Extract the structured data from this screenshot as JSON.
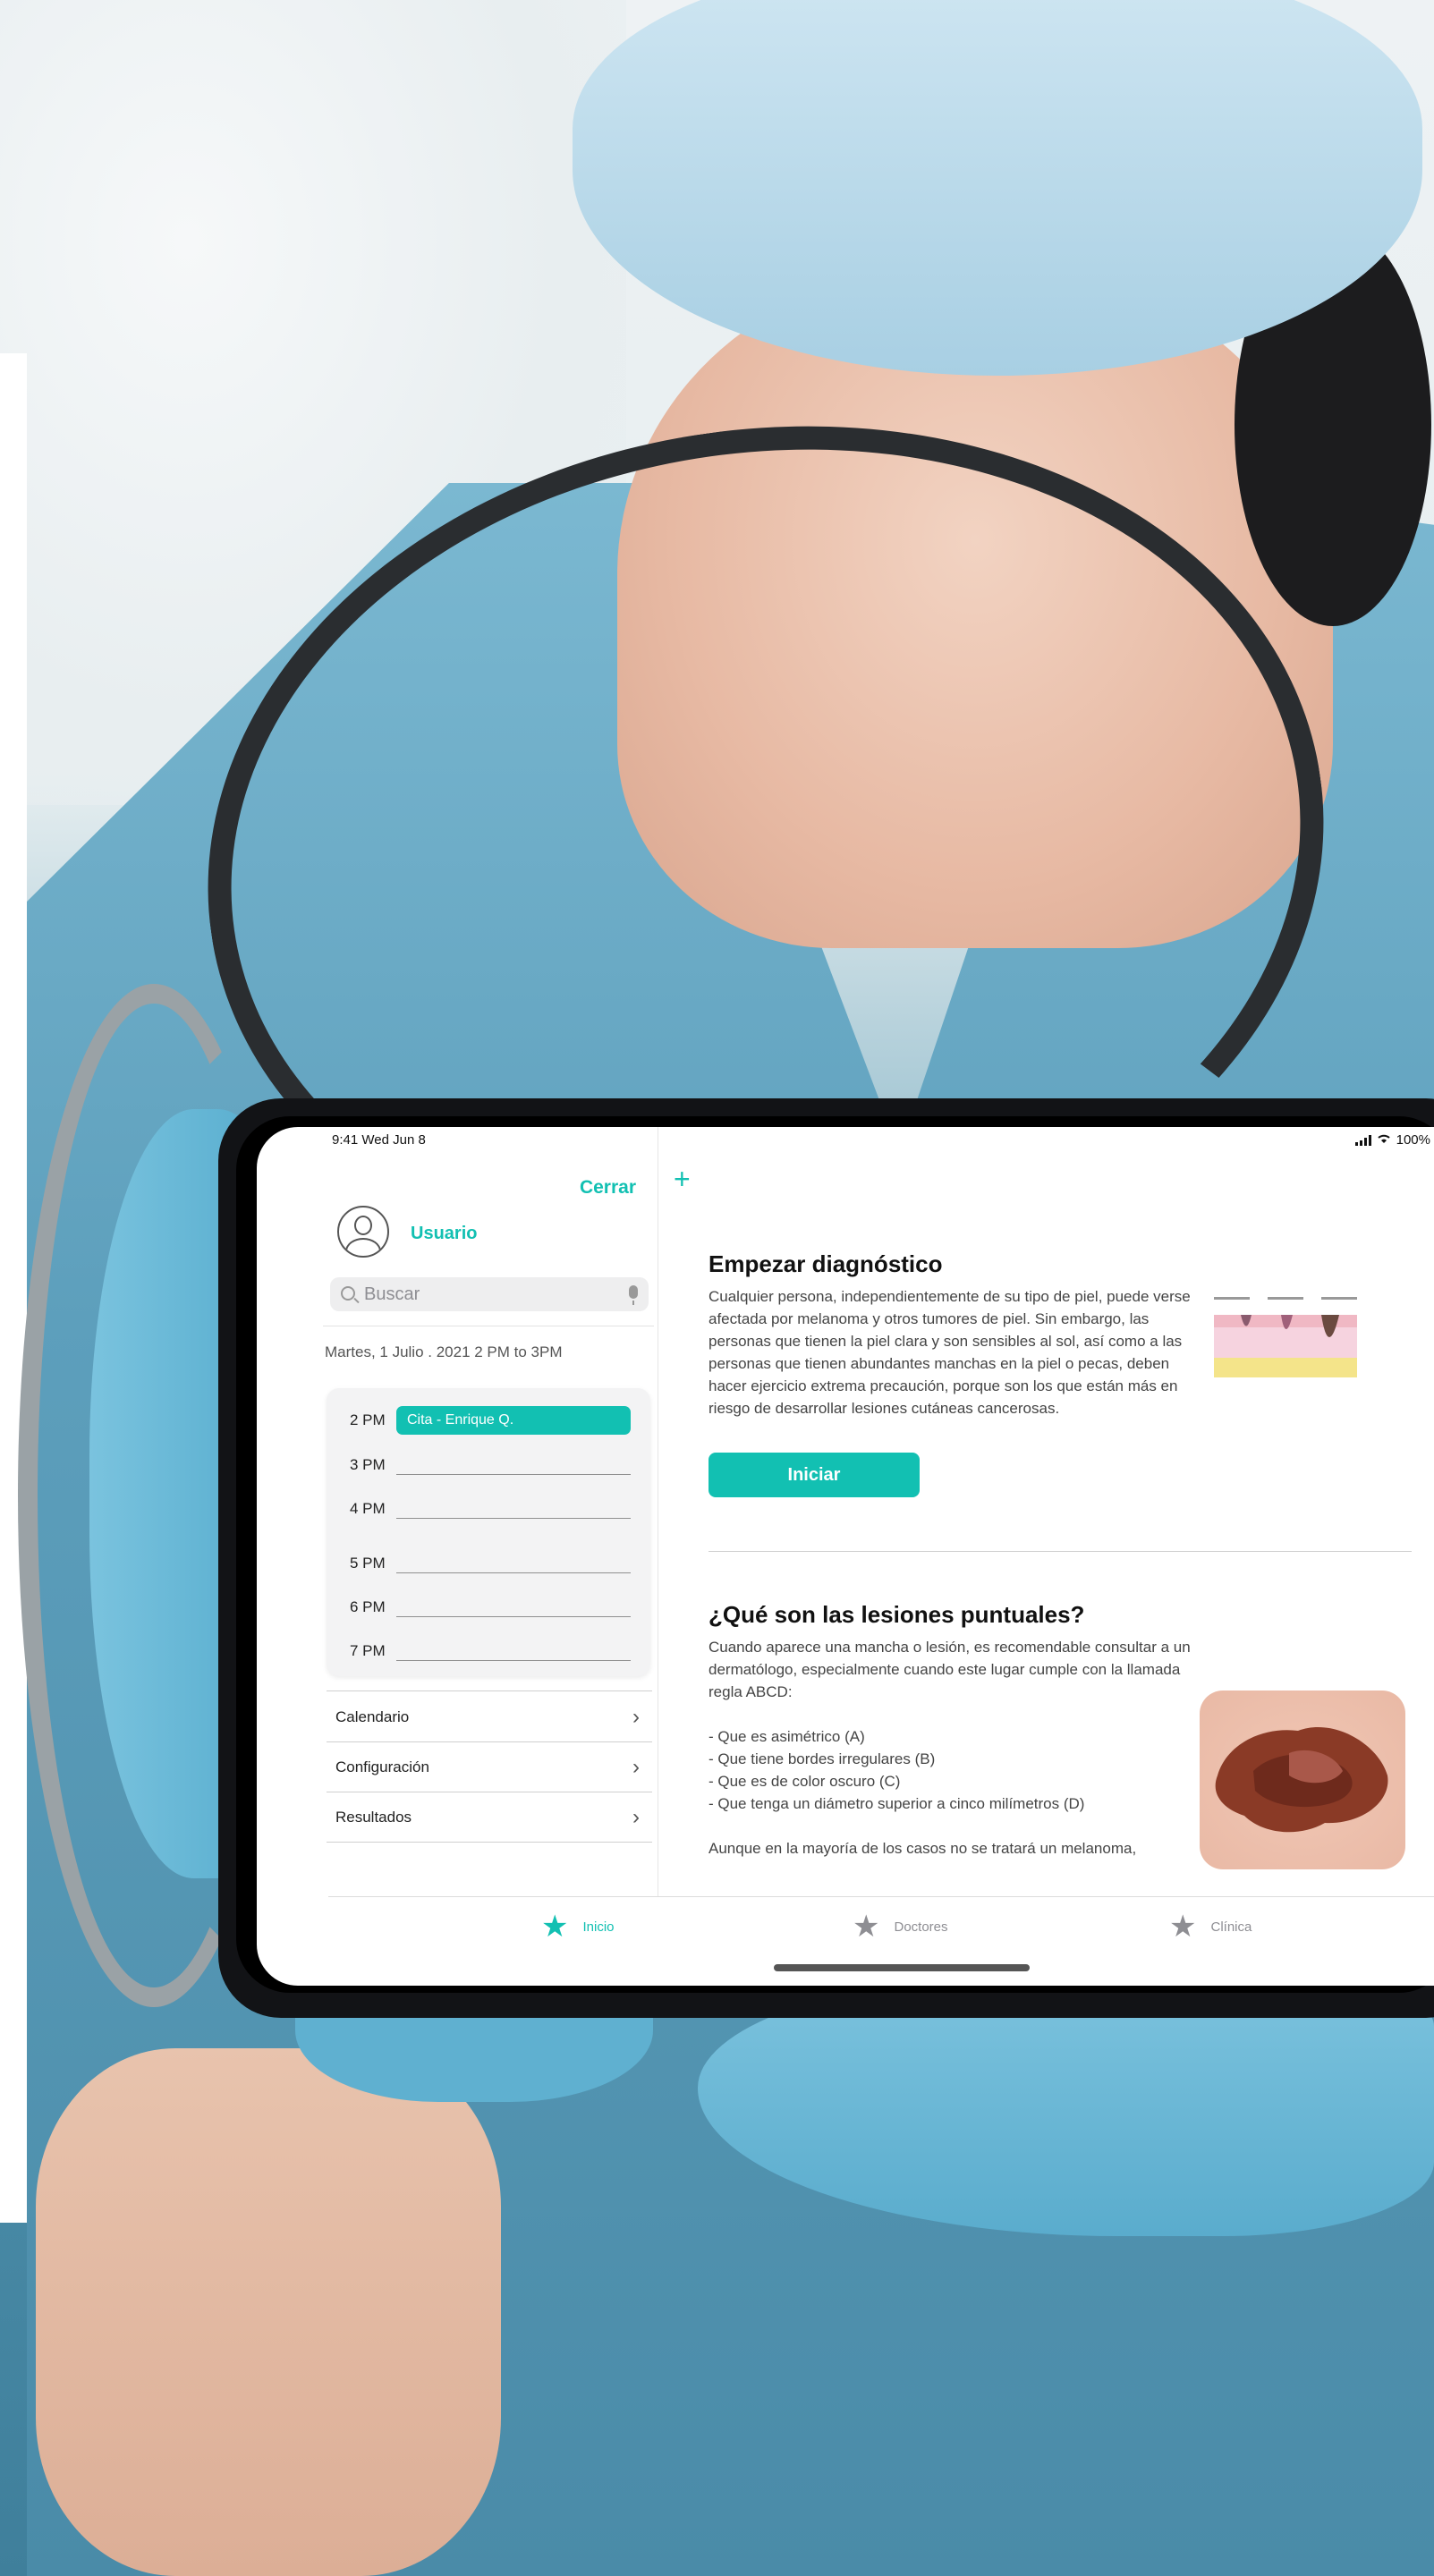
{
  "status": {
    "time": "9:41  Wed Jun 8",
    "battery": "100%"
  },
  "sidebar": {
    "close_label": "Cerrar",
    "user_name": "Usuario",
    "search_placeholder": "Buscar",
    "date_range": "Martes, 1 Julio . 2021 2 PM to 3PM",
    "schedule": [
      {
        "time": "2 PM",
        "event": "Cita - Enrique Q."
      },
      {
        "time": "3 PM",
        "event": ""
      },
      {
        "time": "4 PM",
        "event": ""
      },
      {
        "time": "5 PM",
        "event": ""
      },
      {
        "time": "6 PM",
        "event": ""
      },
      {
        "time": "7 PM",
        "event": ""
      }
    ],
    "menu": [
      {
        "label": "Calendario"
      },
      {
        "label": "Configuración"
      },
      {
        "label": "Resultados"
      }
    ]
  },
  "main": {
    "section1_title": "Empezar diagnóstico",
    "section1_body": "Cualquier persona, independientemente de su tipo de piel, puede verse afectada por melanoma y otros tumores de piel. Sin embargo, las personas que tienen la piel clara y son sensibles al sol, así como a las personas que tienen abundantes manchas en la piel o pecas, deben hacer ejercicio extrema precaución, porque son los que están más en riesgo de desarrollar lesiones cutáneas cancerosas.",
    "start_button": "Iniciar",
    "section2_title": "¿Qué son las lesiones puntuales?",
    "section2_body": "Cuando aparece una mancha o lesión, es recomendable consultar a un dermatólogo, especialmente cuando este lugar cumple con la llamada regla ABCD:",
    "abcd": [
      "- Que es asimétrico (A)",
      "- Que tiene bordes irregulares (B)",
      "- Que es de color oscuro (C)",
      "- Que tenga un diámetro superior a cinco milímetros (D)"
    ],
    "section2_footer": "Aunque en la mayoría de los casos no se tratará un melanoma,"
  },
  "tabbar": {
    "items": [
      {
        "label": "Inicio",
        "icon": "star-icon",
        "active": true
      },
      {
        "label": "Doctores",
        "icon": "star-icon",
        "active": false
      },
      {
        "label": "Clínica",
        "icon": "star-icon",
        "active": false
      }
    ]
  },
  "colors": {
    "accent": "#12c0b2",
    "inactive": "#8e8e93"
  }
}
